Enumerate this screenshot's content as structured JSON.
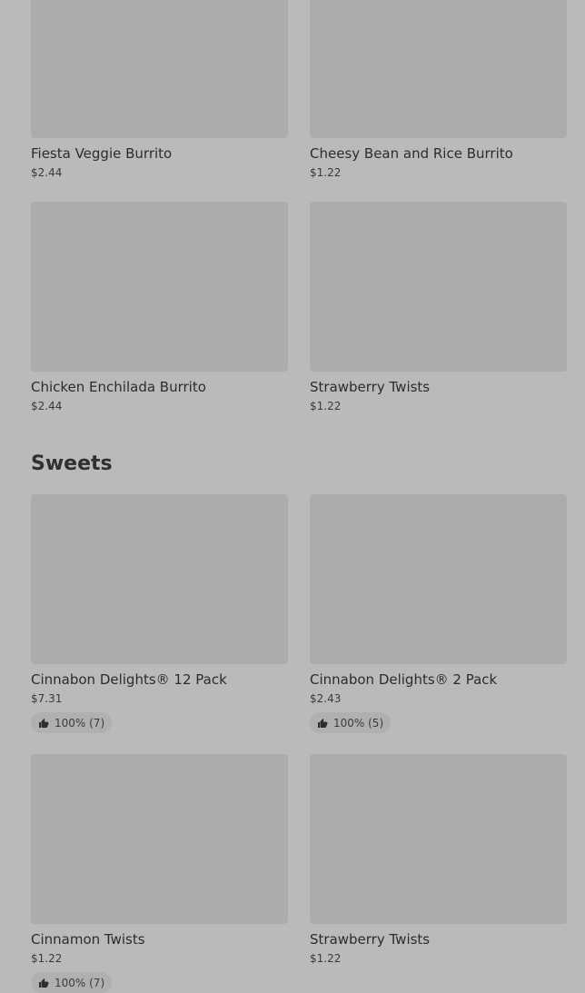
{
  "section_title": "Sweets",
  "colors": {
    "background": "#bababa",
    "placeholder": "#acacac",
    "badge": "#b0b0b0"
  },
  "top_items": [
    {
      "name": "Fiesta Veggie Burrito",
      "price": "$2.44"
    },
    {
      "name": "Cheesy Bean and Rice Burrito",
      "price": "$1.22"
    },
    {
      "name": "Chicken Enchilada Burrito",
      "price": "$2.44"
    },
    {
      "name": "Strawberry Twists",
      "price": "$1.22"
    }
  ],
  "sweets": [
    {
      "name": "Cinnabon Delights® 12 Pack",
      "price": "$7.31",
      "rating": "100% (7)"
    },
    {
      "name": "Cinnabon Delights® 2 Pack",
      "price": "$2.43",
      "rating": "100% (5)"
    },
    {
      "name": "Cinnamon Twists",
      "price": "$1.22",
      "rating": "100% (7)"
    },
    {
      "name": "Strawberry Twists",
      "price": "$1.22"
    }
  ]
}
